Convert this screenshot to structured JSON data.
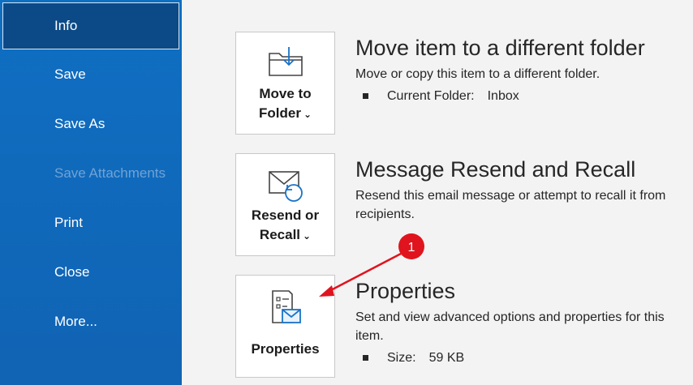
{
  "sidebar": {
    "items": [
      {
        "label": "Info",
        "active": true,
        "enabled": true
      },
      {
        "label": "Save",
        "active": false,
        "enabled": true
      },
      {
        "label": "Save As",
        "active": false,
        "enabled": true
      },
      {
        "label": "Save Attachments",
        "active": false,
        "enabled": false
      },
      {
        "label": "Print",
        "active": false,
        "enabled": true
      },
      {
        "label": "Close",
        "active": false,
        "enabled": true
      },
      {
        "label": "More...",
        "active": false,
        "enabled": true
      }
    ]
  },
  "sections": {
    "move": {
      "button_line1": "Move to",
      "button_line2": "Folder",
      "title": "Move item to a different folder",
      "description": "Move or copy this item to a different folder.",
      "detail_label": "Current Folder:",
      "detail_value": "Inbox",
      "icon": "move-to-folder-icon"
    },
    "resend": {
      "button_line1": "Resend or",
      "button_line2": "Recall",
      "title": "Message Resend and Recall",
      "description": "Resend this email message or attempt to recall it from recipients.",
      "icon": "resend-recall-icon"
    },
    "properties": {
      "button_label": "Properties",
      "title": "Properties",
      "description": "Set and view advanced options and properties for this item.",
      "detail_label": "Size:",
      "detail_value": "59 KB",
      "icon": "properties-icon"
    }
  },
  "annotation": {
    "step_number": "1",
    "color": "#e0141e"
  },
  "colors": {
    "sidebar_bg": "#1163b3",
    "sidebar_active": "#0b4a86",
    "icon_blue": "#1a73c7"
  }
}
